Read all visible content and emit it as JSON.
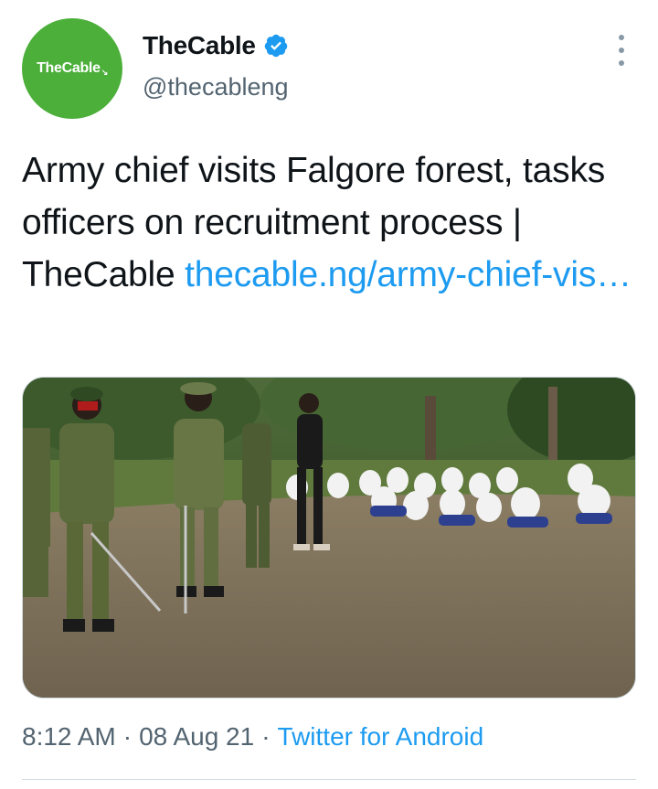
{
  "account": {
    "avatar_text": "TheCable",
    "display_name": "TheCable",
    "handle": "@thecableng",
    "verified": true,
    "avatar_color": "#4caf3a"
  },
  "tweet": {
    "text": "Army chief visits Falgore forest, tasks officers on recruitment process | TheCable ",
    "link_text": "thecable.ng/​army-chief-vis…",
    "image_description_icon": "photo-icon"
  },
  "meta": {
    "time": "8:12 AM",
    "date": "08 Aug 21",
    "source": "Twitter for Android",
    "separator": "·"
  },
  "colors": {
    "link": "#1d9bf0",
    "secondary_text": "#536471"
  }
}
